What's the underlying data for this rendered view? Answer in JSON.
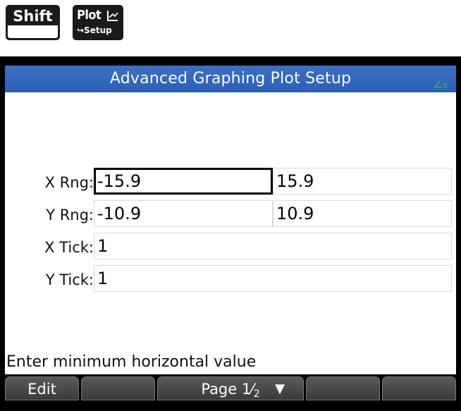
{
  "keys": {
    "shift_label": "Shift",
    "plot_label": "Plot",
    "plot_icon": "plot-graph-icon",
    "plot_shift_label": "↪Setup"
  },
  "screen": {
    "title": "Advanced Graphing Plot Setup",
    "angle_indicator_color": "#22cc22",
    "titlebar_color": "#3368bf"
  },
  "form": {
    "x_rng": {
      "label": "X Rng:",
      "min": "-15.9",
      "max": "15.9"
    },
    "y_rng": {
      "label": "Y Rng:",
      "min": "-10.9",
      "max": "10.9"
    },
    "x_tick": {
      "label": "X Tick:",
      "value": "1"
    },
    "y_tick": {
      "label": "Y Tick:",
      "value": "1"
    }
  },
  "hint": "Enter minimum horizontal value",
  "softkeys": {
    "edit": "Edit",
    "page_label": "Page 1",
    "page_den": "2",
    "page_arrow": "▼"
  }
}
